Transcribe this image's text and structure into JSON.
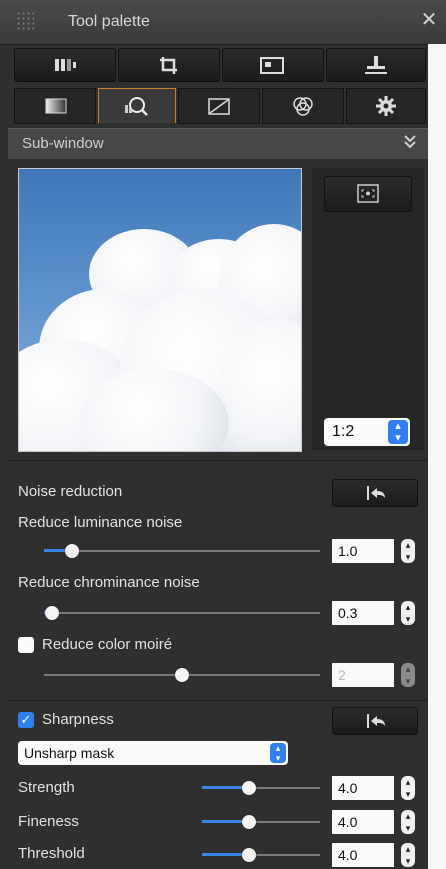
{
  "window": {
    "title": "Tool palette",
    "close_glyph": "✕"
  },
  "tool_buttons": [
    {
      "icon": "split-compare-icon"
    },
    {
      "icon": "crop-icon"
    },
    {
      "icon": "image-layout-icon"
    },
    {
      "icon": "stamp-icon"
    }
  ],
  "tabs": [
    {
      "icon": "brightness-icon",
      "active": false
    },
    {
      "icon": "detail-magnify-icon",
      "active": true
    },
    {
      "icon": "curve-icon",
      "active": false
    },
    {
      "icon": "color-wheel-icon",
      "active": false
    },
    {
      "icon": "settings-gear-icon",
      "active": false
    }
  ],
  "subwindow": {
    "title": "Sub-window",
    "collapse_glyph": "»",
    "zoom": {
      "value": "1:2",
      "options_glyph": "⌃⌄"
    }
  },
  "noise": {
    "title": "Noise reduction",
    "luminance": {
      "label": "Reduce luminance noise",
      "value": "1.0",
      "slider_fraction": 0.1
    },
    "chrominance": {
      "label": "Reduce chrominance noise",
      "value": "0.3",
      "slider_fraction": 0.03
    },
    "moire": {
      "label": "Reduce color moiré",
      "checked": false,
      "value": "2",
      "slider_fraction": 0.5
    }
  },
  "sharpness": {
    "label": "Sharpness",
    "checked": true,
    "mode": "Unsharp mask",
    "params": [
      {
        "label": "Strength",
        "value": "4.0",
        "slider_fraction": 0.4
      },
      {
        "label": "Fineness",
        "value": "4.0",
        "slider_fraction": 0.4
      },
      {
        "label": "Threshold",
        "value": "4.0",
        "slider_fraction": 0.4
      }
    ]
  },
  "colors": {
    "accent": "#2f7ff0",
    "active_tab_border": "#d07a28",
    "panel_bg": "#2f2f2f"
  }
}
